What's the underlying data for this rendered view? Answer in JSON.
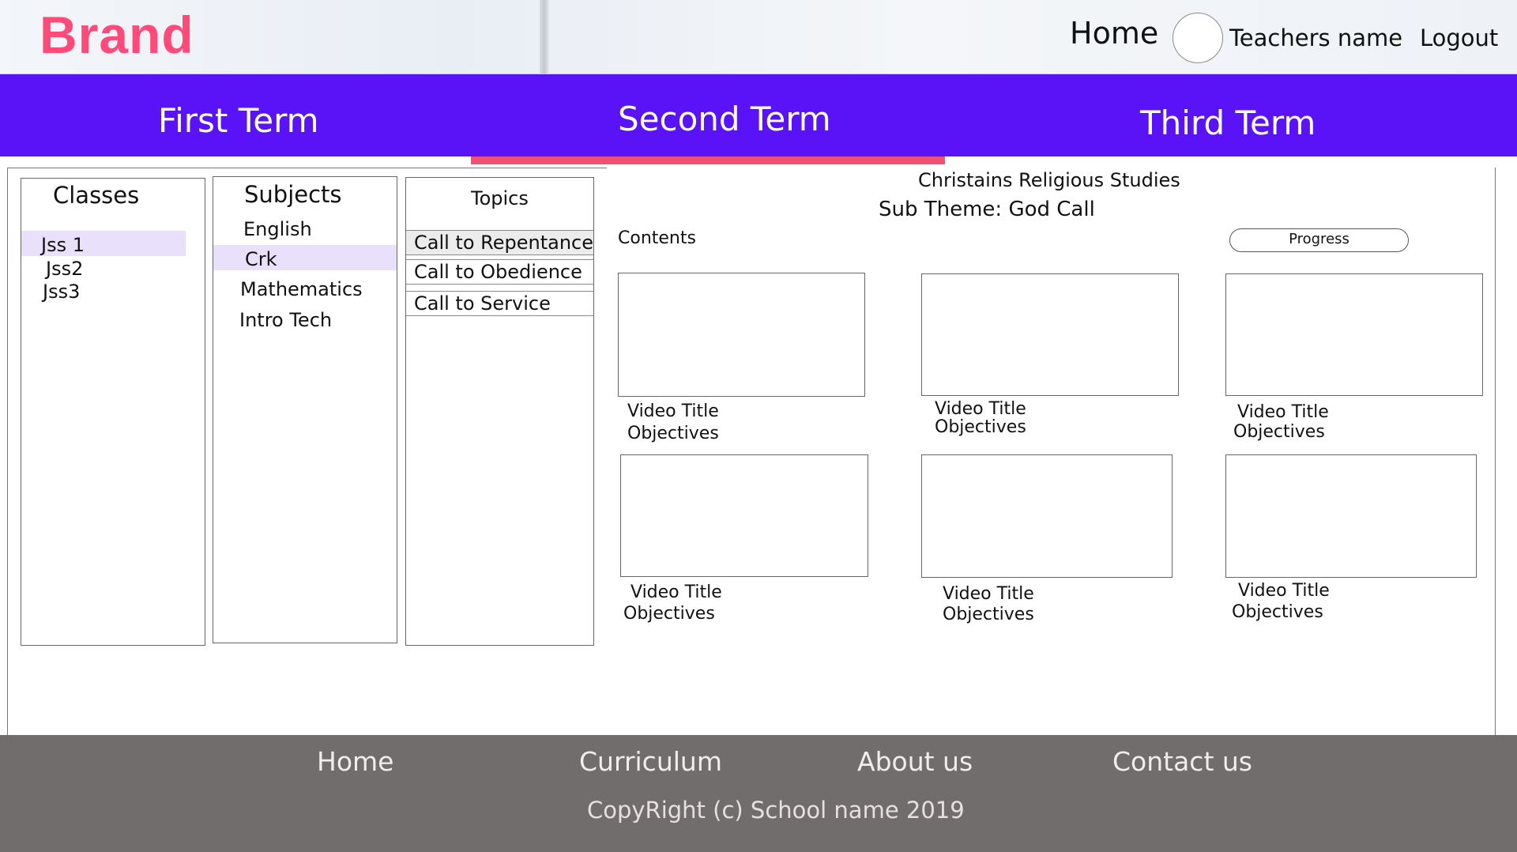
{
  "header": {
    "brand": "Brand",
    "home": "Home",
    "teacher_name": "Teachers name",
    "logout": "Logout"
  },
  "terms": {
    "items": [
      "First Term",
      "Second Term",
      "Third Term"
    ],
    "active_index": 1,
    "active_color": "#ef5170",
    "bar_color": "#5a12f7"
  },
  "classes": {
    "title": "Classes",
    "items": [
      "Jss 1",
      "Jss2",
      "Jss3"
    ],
    "selected": "Jss 1"
  },
  "subjects": {
    "title": "Subjects",
    "items": [
      "English",
      "Crk",
      "Mathematics",
      "Intro Tech"
    ],
    "selected": "Crk"
  },
  "topics": {
    "title": "Topics",
    "items": [
      "Call to Repentance",
      "Call to Obedience",
      "Call to Service"
    ],
    "selected": "Call to Repentance"
  },
  "main": {
    "subject_title": "Christains Religious Studies",
    "sub_theme": "Sub Theme: God Call",
    "contents_label": "Contents",
    "progress_label": "Progress",
    "videos": [
      {
        "title": "Video Title",
        "objectives": "Objectives"
      },
      {
        "title": "Video Title",
        "objectives": "Objectives"
      },
      {
        "title": "Video Title",
        "objectives": "Objectives"
      },
      {
        "title": "Video Title",
        "objectives": "Objectives"
      },
      {
        "title": "Video Title",
        "objectives": "Objectives"
      },
      {
        "title": "Video Title",
        "objectives": "Objectives"
      }
    ]
  },
  "footer": {
    "links": [
      "Home",
      "Curriculum",
      "About us",
      "Contact us"
    ],
    "copyright": "CopyRight (c) School name 2019"
  },
  "colors": {
    "brand": "#ff4a7a",
    "selection": "#e9e1fb",
    "footer_bg": "#726d6d"
  }
}
